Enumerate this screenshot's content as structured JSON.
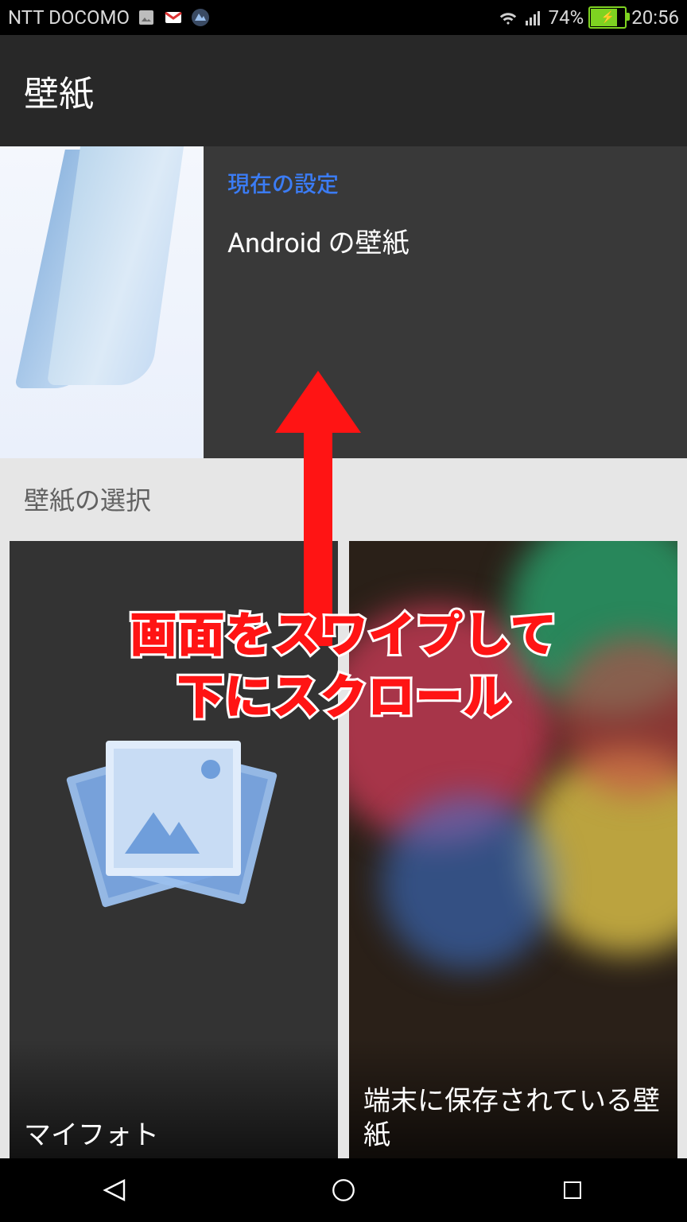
{
  "status": {
    "carrier": "NTT DOCOMO",
    "battery_pct": "74%",
    "clock": "20:56"
  },
  "appbar": {
    "title": "壁紙"
  },
  "current": {
    "label": "現在の設定",
    "name": "Android の壁紙"
  },
  "section": {
    "title": "壁紙の選択"
  },
  "tiles": {
    "my_photos": "マイフォト",
    "local": "端末に保存されている壁紙"
  },
  "annotation": {
    "text": "画面をスワイプして\n下にスクロール"
  }
}
